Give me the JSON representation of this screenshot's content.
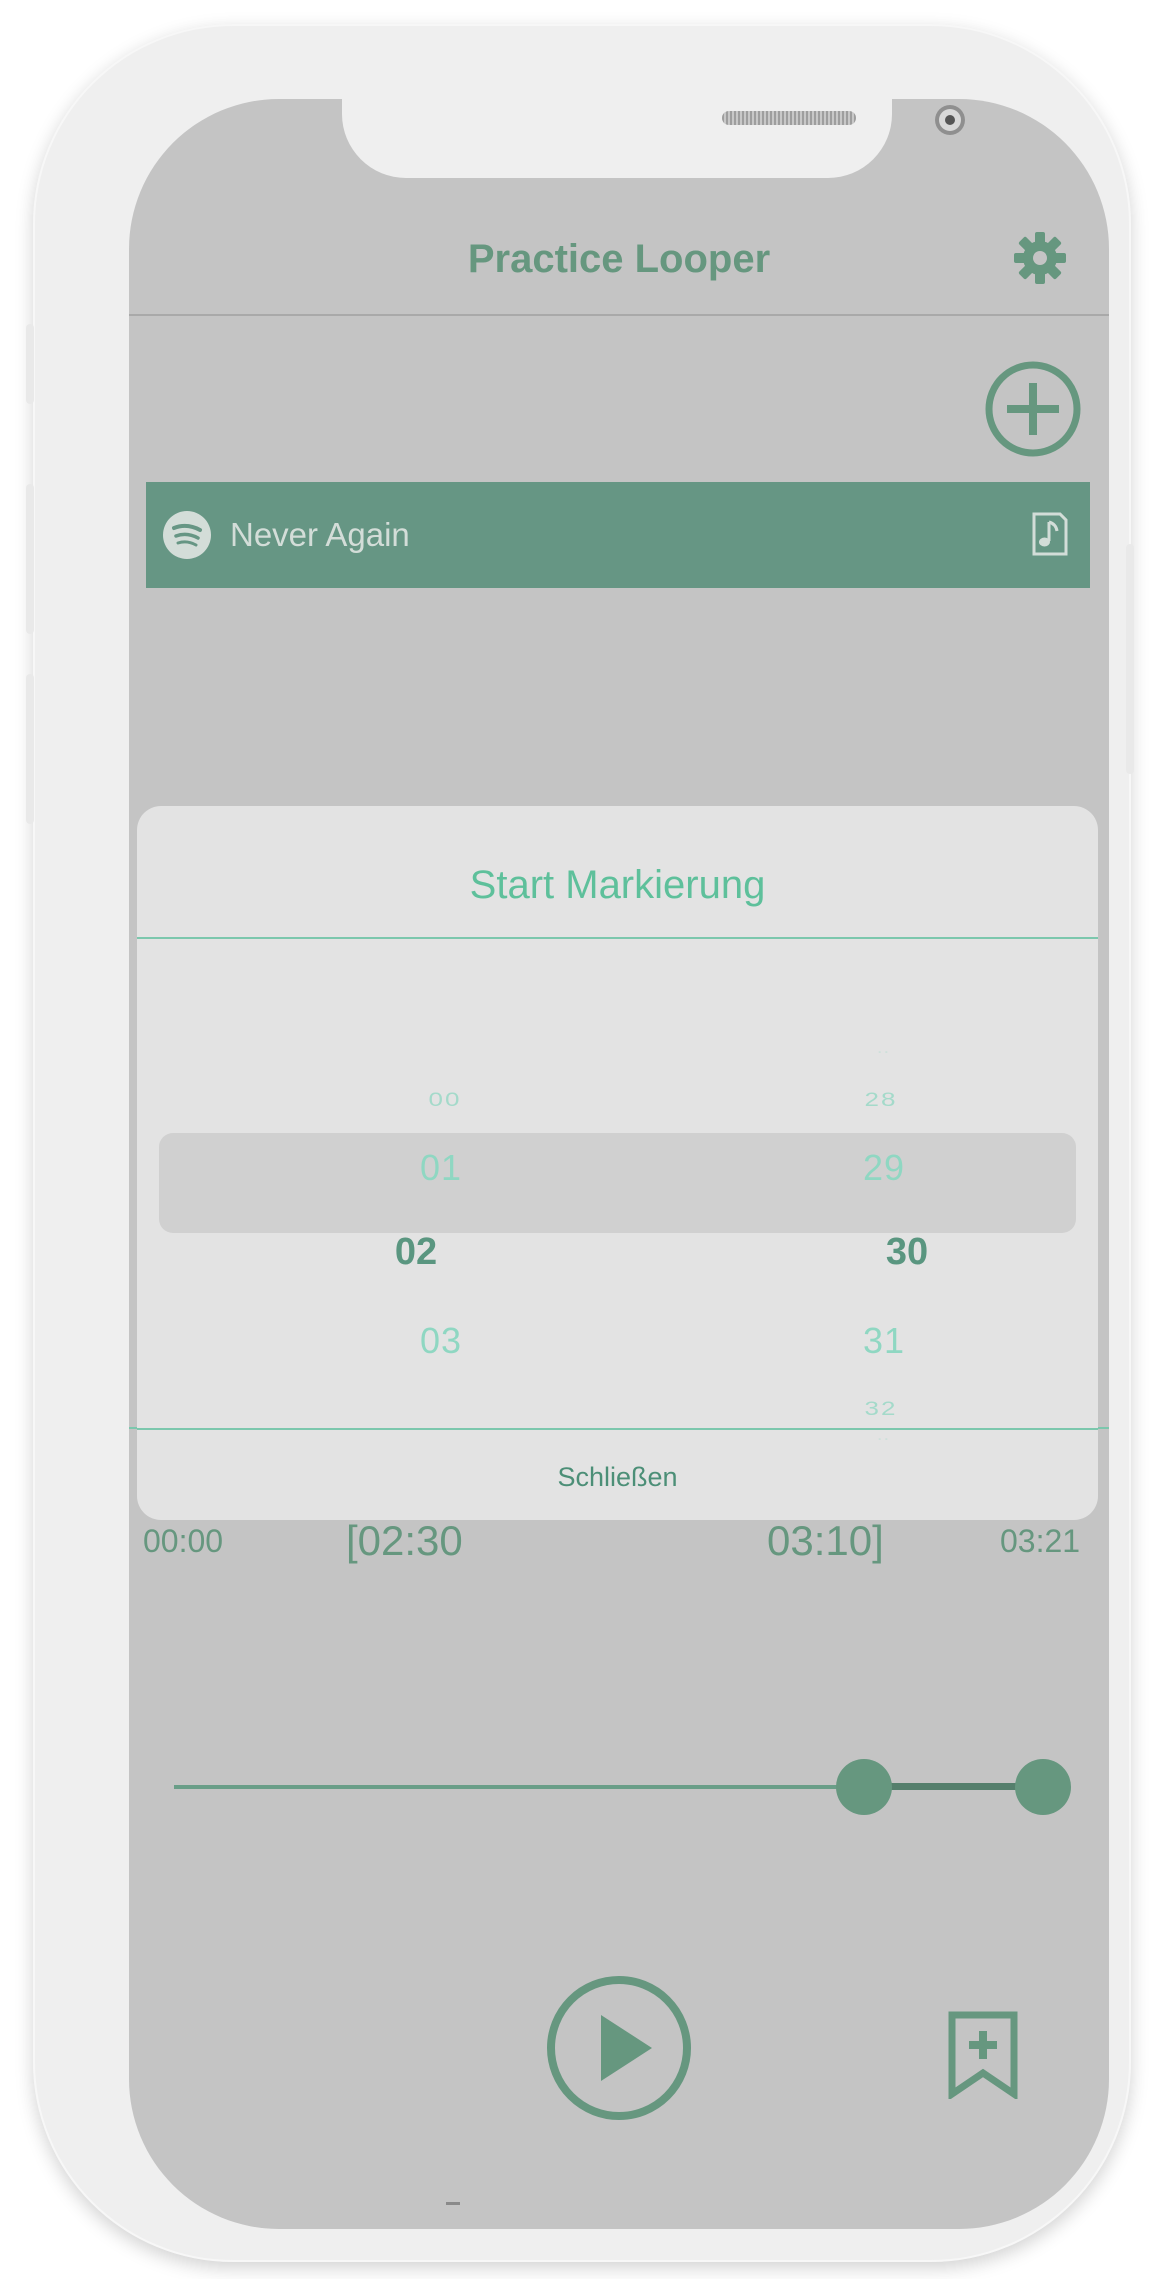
{
  "app": {
    "title": "Practice Looper"
  },
  "track": {
    "name": "Never Again"
  },
  "times": {
    "start": "00:00",
    "loop_start": "[02:30",
    "loop_end": "03:10]",
    "end": "03:21"
  },
  "slider": {
    "loop_start_fraction": 0.777,
    "loop_end_fraction": 0.979
  },
  "dialog": {
    "title": "Start Markierung",
    "close_label": "Schließen",
    "minutes": {
      "above2": "00",
      "above1": "01",
      "selected": "02",
      "below1": "03"
    },
    "seconds": {
      "above2": "28",
      "above1": "29",
      "selected": "30",
      "below1": "31",
      "below2": "32"
    }
  },
  "colors": {
    "accent": "#66977f",
    "picker_text": "#8fd7c2",
    "title_mint": "#5ec09b"
  }
}
